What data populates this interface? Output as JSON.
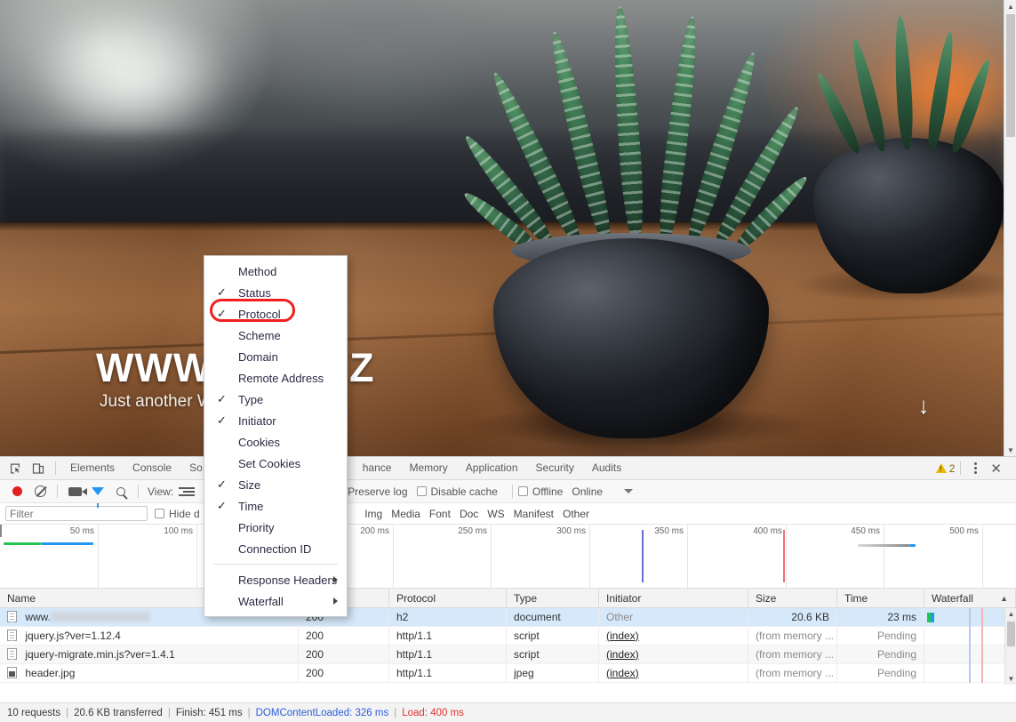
{
  "page": {
    "hero_title": "WWW.                 ST.XYZ",
    "hero_subtitle": "Just another W",
    "scroll_arrow": "↓"
  },
  "devtools": {
    "tabs": [
      {
        "label": "Elements",
        "active": false
      },
      {
        "label": "Console",
        "active": false
      },
      {
        "label": "So",
        "active": false
      },
      {
        "label": "hance",
        "active": false
      },
      {
        "label": "Memory",
        "active": false
      },
      {
        "label": "Application",
        "active": false
      },
      {
        "label": "Security",
        "active": false
      },
      {
        "label": "Audits",
        "active": false
      }
    ],
    "warning_count": "2",
    "close_label": "✕",
    "inspect_icon": "inspect-element-icon",
    "device_icon": "device-toolbar-icon"
  },
  "network_toolbar": {
    "record_label": "record-button",
    "clear_label": "clear-button",
    "capture_screenshots_label": "camera-icon",
    "filter_label": "filter-icon",
    "search_label": "search-icon",
    "view_label": "View:",
    "preserve_log_label": "Preserve log",
    "disable_cache_label": "Disable cache",
    "offline_label": "Offline",
    "throttling_label": "Online"
  },
  "filter_bar": {
    "placeholder": "Filter",
    "value": "",
    "hide_data_urls_label": "Hide d",
    "types": [
      "Img",
      "Media",
      "Font",
      "Doc",
      "WS",
      "Manifest",
      "Other"
    ]
  },
  "overview": {
    "tick_labels": [
      "50 ms",
      "100 ms",
      "200 ms",
      "250 ms",
      "300 ms",
      "350 ms",
      "400 ms",
      "450 ms",
      "500 ms"
    ],
    "dcl_color": "#6b6bd6",
    "load_color": "#f07070"
  },
  "table": {
    "columns": [
      "Name",
      "Status",
      "Protocol",
      "Type",
      "Initiator",
      "Size",
      "Time",
      "Waterfall"
    ],
    "sort_indicator": "▲",
    "rows": [
      {
        "name": "www.",
        "name_redacted": true,
        "icon": "document-file-icon",
        "status": "200",
        "protocol": "h2",
        "type": "document",
        "initiator": "Other",
        "initiator_link": false,
        "size": "20.6 KB",
        "time": "23 ms",
        "selected": true
      },
      {
        "name": "jquery.js?ver=1.12.4",
        "name_redacted": false,
        "icon": "script-file-icon",
        "status": "200",
        "protocol": "http/1.1",
        "type": "script",
        "initiator": "(index)",
        "initiator_link": true,
        "size": "(from memory ...",
        "time": "Pending",
        "selected": false
      },
      {
        "name": "jquery-migrate.min.js?ver=1.4.1",
        "name_redacted": false,
        "icon": "script-file-icon",
        "status": "200",
        "protocol": "http/1.1",
        "type": "script",
        "initiator": "(index)",
        "initiator_link": true,
        "size": "(from memory ...",
        "time": "Pending",
        "selected": false
      },
      {
        "name": "header.jpg",
        "name_redacted": false,
        "icon": "image-file-icon",
        "status": "200",
        "protocol": "http/1.1",
        "type": "jpeg",
        "initiator": "(index)",
        "initiator_link": true,
        "size": "(from memory ...",
        "time": "Pending",
        "selected": false
      }
    ]
  },
  "context_menu": {
    "items": [
      {
        "label": "Method",
        "checked": false,
        "submenu": false
      },
      {
        "label": "Status",
        "checked": true,
        "submenu": false
      },
      {
        "label": "Protocol",
        "checked": true,
        "submenu": false,
        "highlighted": true
      },
      {
        "label": "Scheme",
        "checked": false,
        "submenu": false
      },
      {
        "label": "Domain",
        "checked": false,
        "submenu": false
      },
      {
        "label": "Remote Address",
        "checked": false,
        "submenu": false
      },
      {
        "label": "Type",
        "checked": true,
        "submenu": false
      },
      {
        "label": "Initiator",
        "checked": true,
        "submenu": false
      },
      {
        "label": "Cookies",
        "checked": false,
        "submenu": false
      },
      {
        "label": "Set Cookies",
        "checked": false,
        "submenu": false
      },
      {
        "label": "Size",
        "checked": true,
        "submenu": false
      },
      {
        "label": "Time",
        "checked": true,
        "submenu": false
      },
      {
        "label": "Priority",
        "checked": false,
        "submenu": false
      },
      {
        "label": "Connection ID",
        "checked": false,
        "submenu": false
      },
      {
        "separator": true
      },
      {
        "label": "Response Headers",
        "checked": false,
        "submenu": true
      },
      {
        "label": "Waterfall",
        "checked": false,
        "submenu": true
      }
    ],
    "check_glyph": "✓",
    "highlight_color": "#f01e1e"
  },
  "statusbar": {
    "requests": "10 requests",
    "transferred": "20.6 KB transferred",
    "finish": "Finish: 451 ms",
    "dom_content_loaded": "DOMContentLoaded: 326 ms",
    "load": "Load: 400 ms",
    "separator": "|"
  }
}
